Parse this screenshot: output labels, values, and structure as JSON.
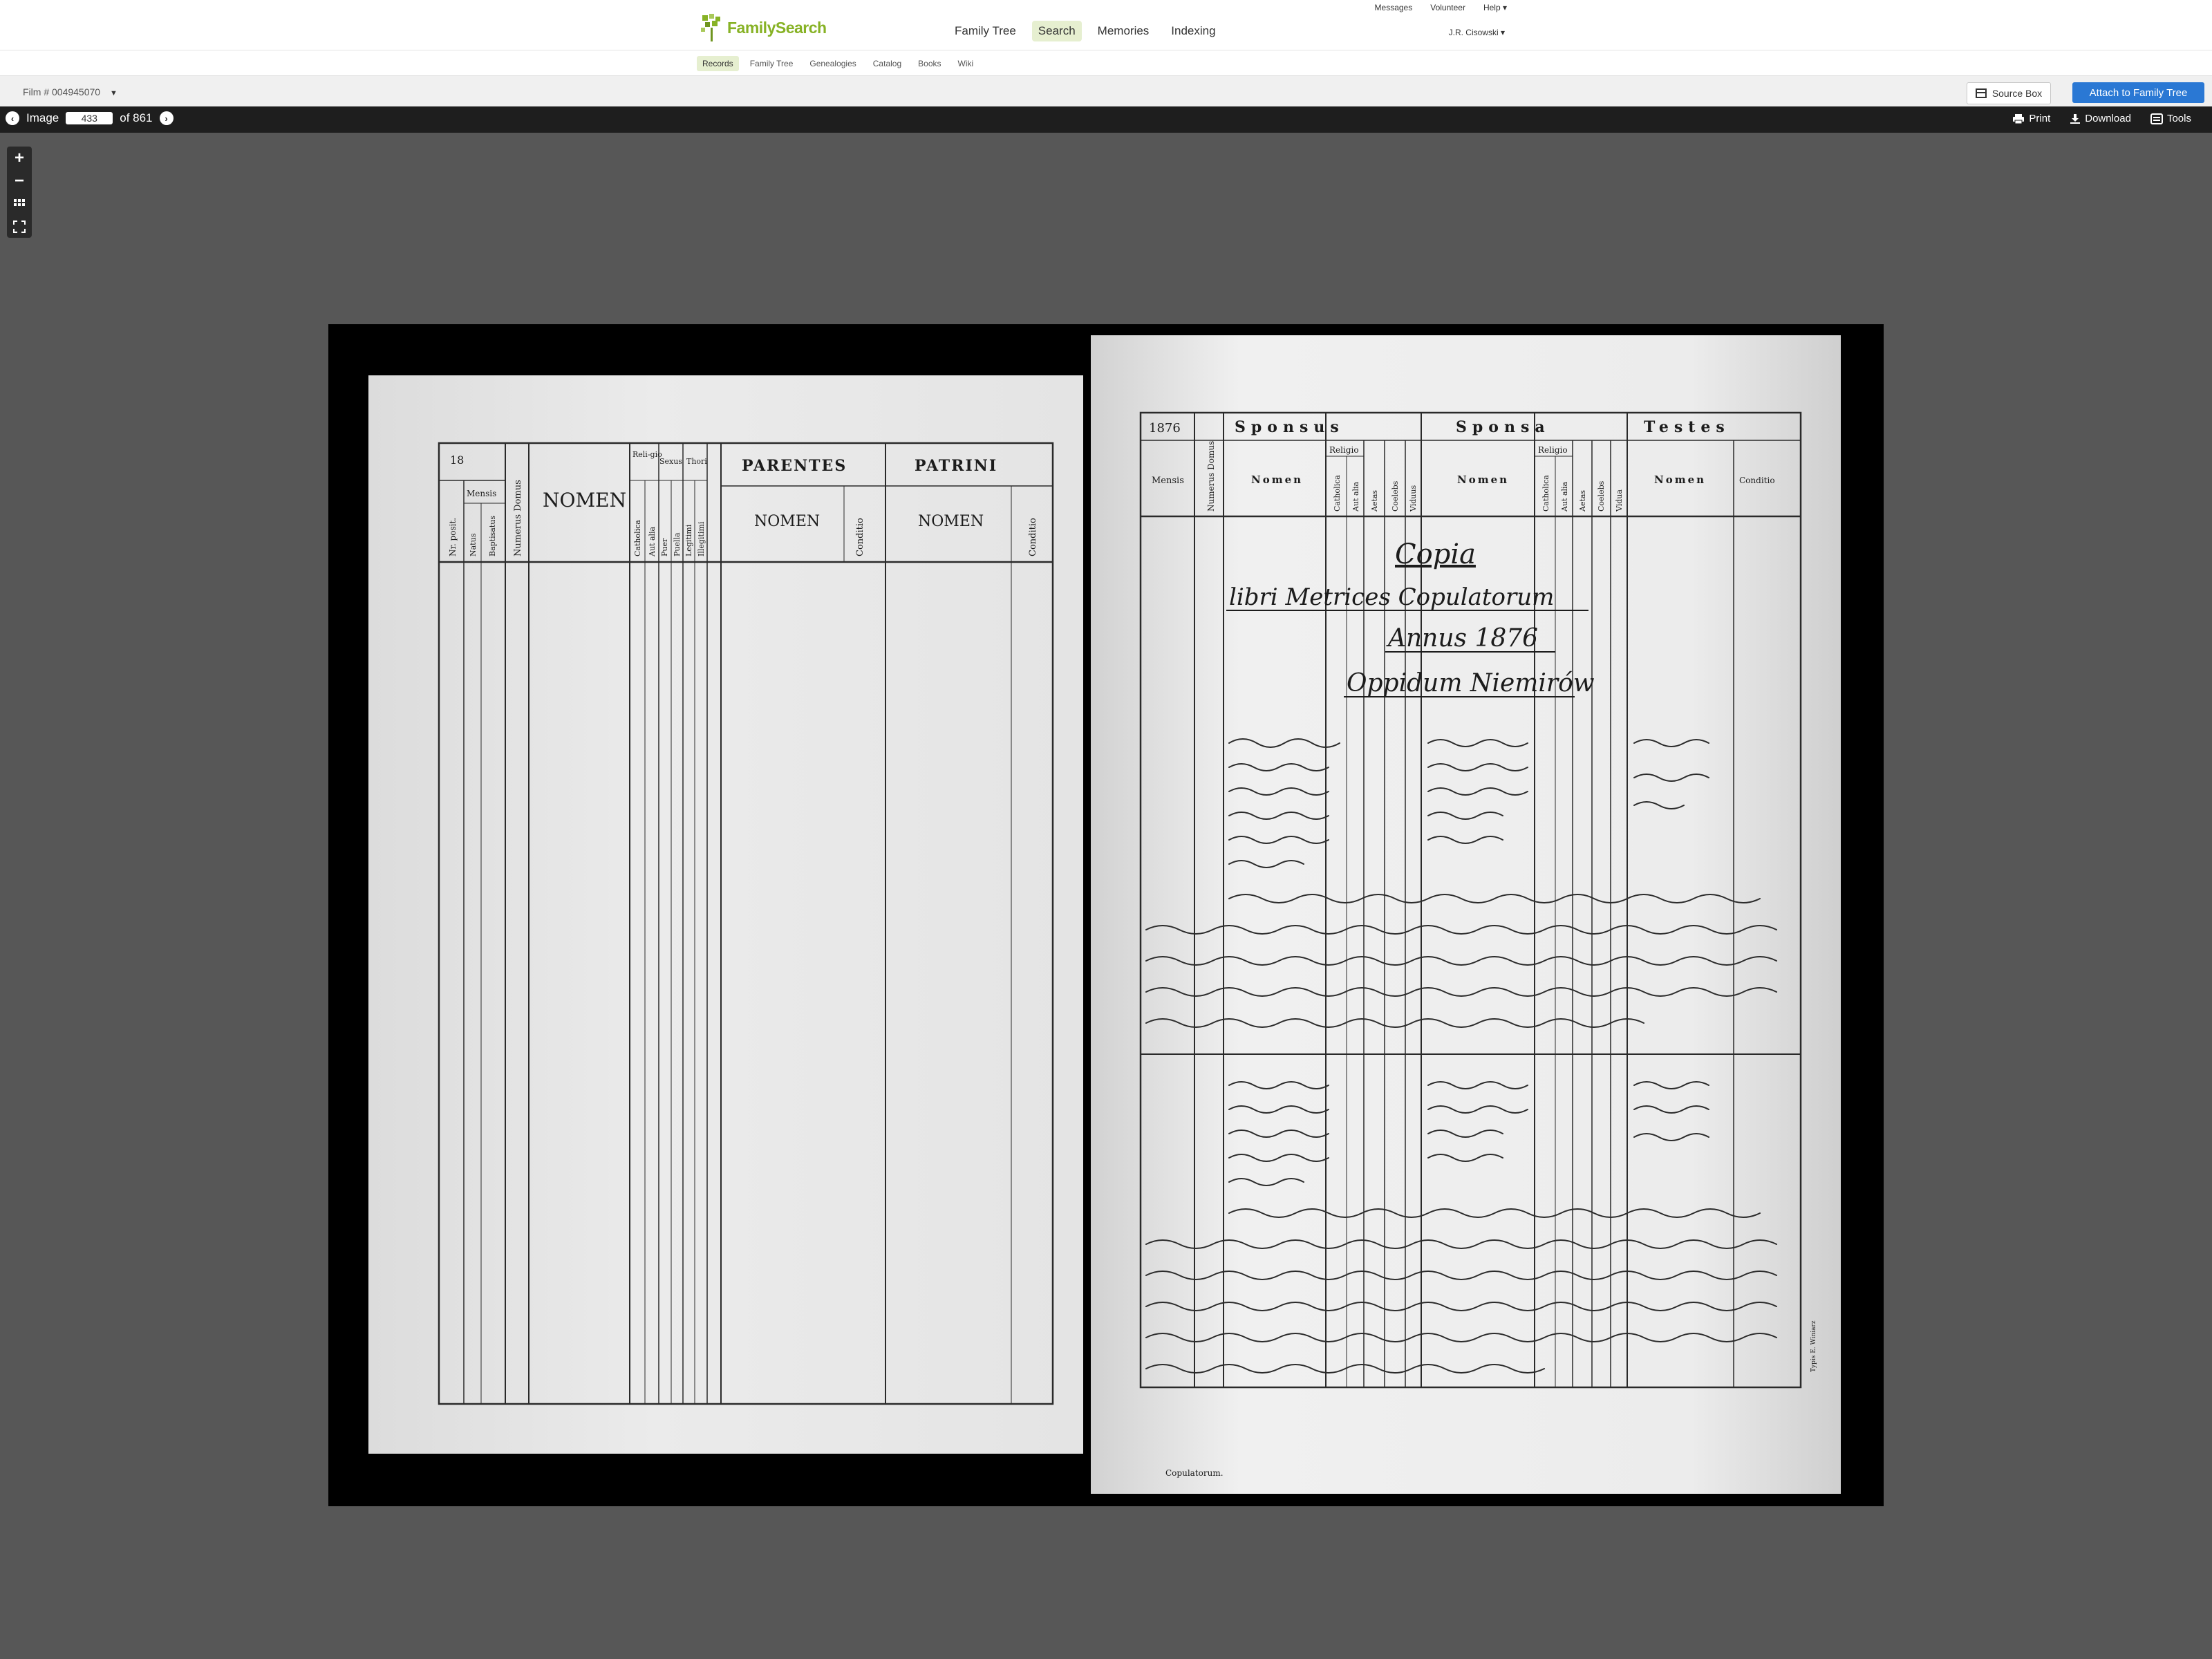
{
  "header": {
    "logo_text": "FamilySearch",
    "main_nav": [
      {
        "label": "Family Tree"
      },
      {
        "label": "Search",
        "active": true
      },
      {
        "label": "Memories"
      },
      {
        "label": "Indexing"
      }
    ],
    "util_nav": [
      "Messages",
      "Volunteer",
      "Help ▾"
    ],
    "user": "J.R. Cisowski ▾"
  },
  "subnav": {
    "items": [
      {
        "label": "Records",
        "active": true
      },
      {
        "label": "Family Tree"
      },
      {
        "label": "Genealogies"
      },
      {
        "label": "Catalog"
      },
      {
        "label": "Books"
      },
      {
        "label": "Wiki"
      }
    ]
  },
  "filmbar": {
    "film_label": "Film # 004945070",
    "source_box": "Source Box",
    "attach": "Attach to Family Tree"
  },
  "image_toolbar": {
    "image_label": "Image",
    "image_number": "433",
    "of_total": "of 861",
    "print": "Print",
    "download": "Download",
    "tools": "Tools"
  },
  "zoom_controls": {
    "zoom_in": "+",
    "zoom_out": "−"
  },
  "document": {
    "left_page": {
      "year_prefix": "18",
      "headers": {
        "nr_posit": "Nr. posit.",
        "mensis": "Mensis",
        "natus": "Natus",
        "baptisatus": "Baptisatus",
        "numerus_domus": "Numerus Domus",
        "nomen": "NOMEN",
        "religio": "Reli-gio",
        "sexus": "Sexus",
        "thori": "Thori",
        "catholica": "Catholica",
        "aut_alia": "Aut alia",
        "puer": "Puer",
        "puella": "Puella",
        "legitimi": "Legitimi",
        "illegitimi": "Illegitimi",
        "parentes": "PARENTES",
        "patrini": "PATRINI",
        "parentes_nomen": "NOMEN",
        "conditio": "Conditio",
        "patrini_nomen": "NOMEN",
        "conditio2": "Conditio"
      }
    },
    "right_page": {
      "year": "1876",
      "headers": {
        "sponsus": "Sponsus",
        "sponsa": "Sponsa",
        "testes": "Testes",
        "mensis": "Mensis",
        "numerus_domus": "Numerus Domus",
        "nomen": "Nomen",
        "religio": "Religio",
        "catholica": "Catholica",
        "aut_alia": "Aut alia",
        "aetas": "Aetas",
        "coelebs": "Coelebs",
        "viduus": "Viduus",
        "nomen2": "Nomen",
        "religio2": "Religio",
        "catholica2": "Catholica",
        "aut_alia2": "Aut alia",
        "aetas2": "Aetas",
        "coelebs2": "Coelebs",
        "vidua": "Vidua",
        "nomen3": "Nomen",
        "conditio": "Conditio"
      },
      "title_lines": [
        "Copia",
        "libri Metrices Copulatorum",
        "Annus 1876",
        "Oppidum Niemirów"
      ],
      "footer": "Copulatorum.",
      "printer": "Typis E. Winiarz"
    }
  },
  "colors": {
    "brand_green": "#87b225",
    "attach_blue": "#2a78d4",
    "toolbar_dark": "#1e1e1e",
    "viewer_bg": "#575757"
  },
  "icons": [
    "tree-logo-icon",
    "source-box-icon",
    "prev-image-icon",
    "next-image-icon",
    "print-icon",
    "download-icon",
    "tools-icon",
    "zoom-in-icon",
    "zoom-out-icon",
    "grid-view-icon",
    "fullscreen-icon",
    "chevron-down-icon"
  ]
}
